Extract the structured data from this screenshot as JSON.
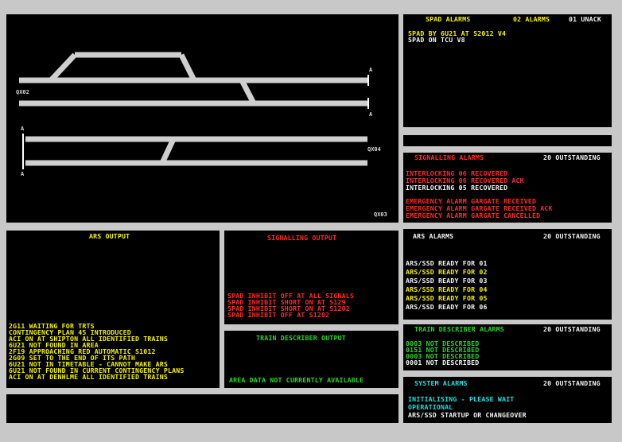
{
  "track_diagram": {
    "labels": {
      "qx02": "QX02",
      "qx04": "QX04",
      "qx03": "QX03",
      "a_top1": "A",
      "a_top2": "A",
      "a_left1": "A",
      "a_left2": "A"
    }
  },
  "spad_alarms": {
    "title": "SPAD ALARMS",
    "count": "02 ALARMS",
    "unack": "01 UNACK",
    "lines": [
      {
        "text": "SPAD BY 6U21 AT S2012 V4",
        "color": "yellow"
      },
      {
        "text": "SPAD ON TCU V8",
        "color": "white"
      }
    ]
  },
  "signalling_alarms": {
    "title": "SIGNALLING ALARMS",
    "outstanding": "20 OUTSTANDING",
    "lines": [
      {
        "text": "INTERLOCKING 06 RECOVERED",
        "color": "red"
      },
      {
        "text": "INTERLOCKING 06 RECOVERED ACK",
        "color": "red"
      },
      {
        "text": "INTERLOCKING 05 RECOVERED",
        "color": "white"
      },
      {
        "text": "EMERGENCY ALARM GARGATE RECEIVED",
        "color": "red"
      },
      {
        "text": "EMERGENCY ALARM GARGATE RECEIVED ACK",
        "color": "red"
      },
      {
        "text": "EMERGENCY ALARM GARGATE CANCELLED",
        "color": "red"
      }
    ]
  },
  "ars_output": {
    "title": "ARS OUTPUT",
    "lines": [
      "2G11 WAITING FOR TRTS",
      "CONTINGENCY PLAN 45 INTRODUCED",
      "ACI ON AT SHIPTON ALL IDENTIFIED TRAINS",
      "6U21 NOT FOUND IN AREA",
      "2F19 APPROACHING RED AUTOMATIC S1012",
      "2G09 SET TO THE END OF ITS PATH",
      "6U21 NOT IN TIMETABLE - CANNOT MAKE ARS",
      "6U21 NOT FOUND IN CURRENT CONTINGENCY PLANS",
      "ACI ON AT DENHLME ALL IDENTIFIED TRAINS"
    ]
  },
  "signalling_output": {
    "title": "SIGNALLING OUTPUT",
    "lines": [
      "SPAD INHIBIT OFF AT ALL SIGNALS",
      "SPAD INHIBIT SHORT ON AT S129",
      "SPAD INHIBIT SHORT ON AT S1202",
      "SPAD INHIBIT OFF AT S1202"
    ]
  },
  "train_describer_output": {
    "title": "TRAIN DESCRIBER OUTPUT",
    "message": "AREA DATA NOT CURRENTLY AVAILABLE"
  },
  "ars_alarms": {
    "title": "ARS ALARMS",
    "outstanding": "20 OUTSTANDING",
    "lines": [
      {
        "text": "ARS/SSD READY FOR 01",
        "color": "white"
      },
      {
        "text": "ARS/SSD READY FOR 02",
        "color": "yellow"
      },
      {
        "text": "ARS/SSD READY FOR 03",
        "color": "white"
      },
      {
        "text": "ARS/SSD READY FOR 04",
        "color": "yellow"
      },
      {
        "text": "ARS/SSD READY FOR 05",
        "color": "yellow"
      },
      {
        "text": "ARS/SSD READY FOR 06",
        "color": "white"
      }
    ]
  },
  "train_describer_alarms": {
    "title": "TRAIN DESCRIBER ALARMS",
    "outstanding": "20 OUTSTANDING",
    "lines": [
      {
        "text": "0003 NOT DESCRIBED",
        "color": "green"
      },
      {
        "text": "0151 NOT DESCRIBED",
        "color": "green"
      },
      {
        "text": "0003 NOT DESCRIBED",
        "color": "green"
      },
      {
        "text": "0001 NOT DESCRIBED",
        "color": "white"
      }
    ]
  },
  "system_alarms": {
    "title": "SYSTEM ALARMS",
    "outstanding": "20 OUTSTANDING",
    "lines": [
      {
        "text": "INITIALISING - PLEASE WAIT",
        "color": "cyan"
      },
      {
        "text": "OPERATIONAL",
        "color": "cyan"
      },
      {
        "text": "ARS/SSD STARTUP OR CHANGEOVER",
        "color": "white"
      }
    ]
  },
  "colors": {
    "yellow": "#f2f200",
    "white": "#f4f4f4",
    "red": "#ff2a2a",
    "green": "#2bd62b",
    "cyan": "#1fe0e0",
    "background": "#c8c8c8"
  }
}
